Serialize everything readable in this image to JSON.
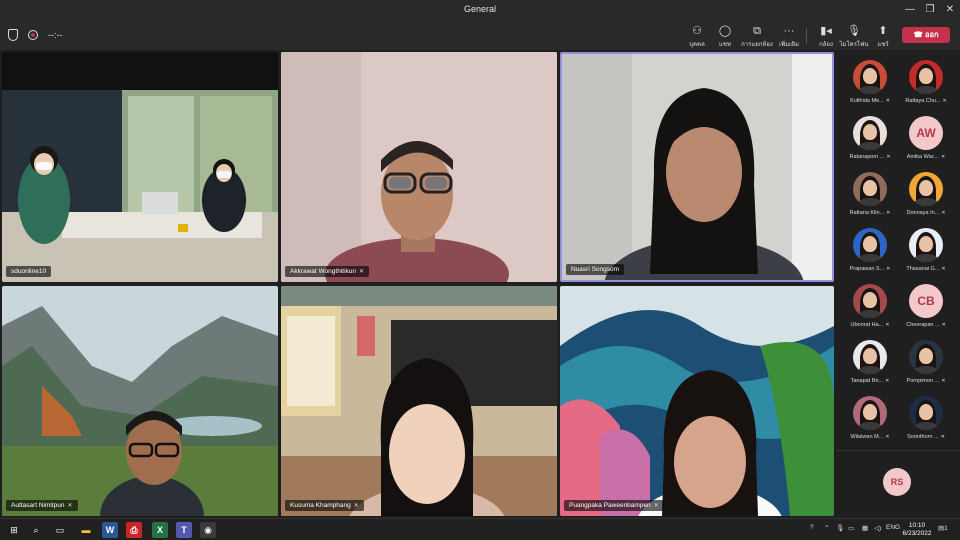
{
  "window": {
    "title": "General",
    "minimize": "—",
    "restore": "❐",
    "close": "✕"
  },
  "meeting": {
    "timer": "--:--"
  },
  "toolbar": {
    "people": "บุคคล",
    "chat": "แชท",
    "rooms": "การแยกห้องประชุม",
    "more": "เพิ่มเติม",
    "camera": "กล้อง",
    "mic": "ไมโครโฟน",
    "share": "แชร์",
    "leave": "ออก"
  },
  "tiles": [
    {
      "name": "sduonline10"
    },
    {
      "name": "Akkrawat Wongthitikun"
    },
    {
      "name": "Nuasri Songsom"
    },
    {
      "name": "Auttasart Nimitpun"
    },
    {
      "name": "Kusuma Khamphang"
    },
    {
      "name": "Puangpaka Paweenbampen"
    }
  ],
  "participants": [
    {
      "name": "Kulthida Me...",
      "initials": "",
      "color": "#c94c38"
    },
    {
      "name": "Rattaya Chu...",
      "initials": "",
      "color": "#c32a2a"
    },
    {
      "name": "Ratanaporn ...",
      "initials": "",
      "color": "#e9dfdc"
    },
    {
      "name": "Amika Wac...",
      "initials": "AW",
      "color": ""
    },
    {
      "name": "Rattana Klin...",
      "initials": "",
      "color": "#8e6b5a"
    },
    {
      "name": "Donnaya In...",
      "initials": "",
      "color": "#f2a735"
    },
    {
      "name": "Prapawan S...",
      "initials": "",
      "color": "#2b66c6"
    },
    {
      "name": "Thasanai G...",
      "initials": "",
      "color": "#e8eef5"
    },
    {
      "name": "Ubonrat Ha...",
      "initials": "",
      "color": "#a24a4a"
    },
    {
      "name": "Cheerapan ...",
      "initials": "CB",
      "color": ""
    },
    {
      "name": "Tanapat Bri...",
      "initials": "",
      "color": "#e9e9e9"
    },
    {
      "name": "Pornpimon ...",
      "initials": "",
      "color": "#2a3440"
    },
    {
      "name": "Wilaiwan M...",
      "initials": "",
      "color": "#b06a7c"
    },
    {
      "name": "Soonthorn ...",
      "initials": "",
      "color": "#1d2b44"
    }
  ],
  "overflow_participant": {
    "initials": "RS"
  },
  "taskbar": {
    "tray_lang": "ENG",
    "time": "10:10",
    "date": "6/23/2022",
    "notif_count": "1"
  }
}
